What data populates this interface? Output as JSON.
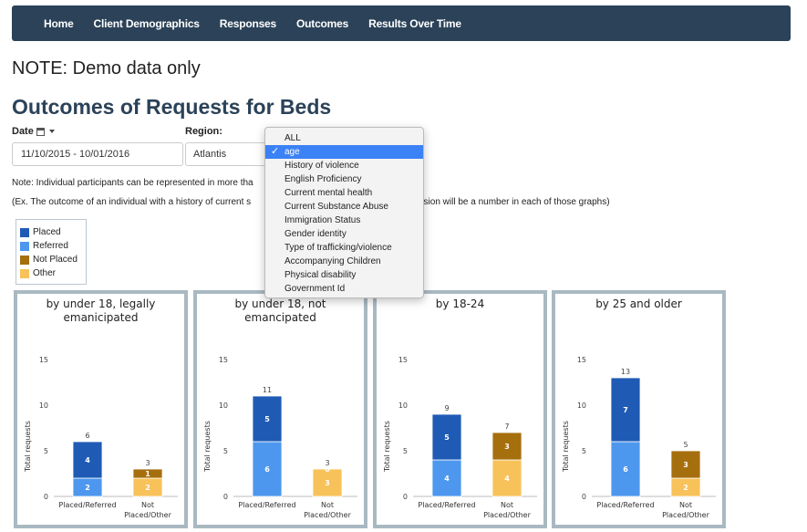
{
  "nav": {
    "items": [
      {
        "label": "Home"
      },
      {
        "label": "Client Demographics"
      },
      {
        "label": "Responses"
      },
      {
        "label": "Outcomes"
      },
      {
        "label": "Results Over Time"
      }
    ]
  },
  "note_demo": "NOTE: Demo data only",
  "page_title": "Outcomes of Requests for Beds",
  "filters": {
    "date_label": "Date",
    "date_value": "11/10/2015 - 10/01/2016",
    "region_label": "Region:",
    "region_value": "Atlantis"
  },
  "notes": {
    "line1": "Note: Individual participants can be represented in more tha",
    "line2": "(Ex. The outcome of an individual with a history of current s",
    "line2_end": "ession will be a number in each of those graphs)"
  },
  "dropdown": {
    "selected": "age",
    "options": [
      {
        "label": "ALL"
      },
      {
        "label": "age"
      },
      {
        "label": "History of violence"
      },
      {
        "label": "English Proficiency"
      },
      {
        "label": "Current mental health"
      },
      {
        "label": "Current Substance Abuse"
      },
      {
        "label": "Immigration Status"
      },
      {
        "label": "Gender identity"
      },
      {
        "label": "Type of trafficking/violence"
      },
      {
        "label": "Accompanying Children"
      },
      {
        "label": "Physical disability"
      },
      {
        "label": "Government Id"
      }
    ]
  },
  "legend": {
    "items": [
      {
        "label": "Placed",
        "color": "#1f5bb5"
      },
      {
        "label": "Referred",
        "color": "#4d98ee"
      },
      {
        "label": "Not Placed",
        "color": "#a66f0e"
      },
      {
        "label": "Other",
        "color": "#f8c25a"
      }
    ]
  },
  "chart_data": [
    {
      "type": "bar",
      "stacked": true,
      "title": "by under 18, legally emanicipated",
      "ylabel": "Total requests",
      "ylim": [
        0,
        15
      ],
      "yticks": [
        0,
        5,
        10,
        15
      ],
      "categories": [
        "Placed/Referred",
        "Not Placed/Other"
      ],
      "series": [
        {
          "name": "Referred",
          "stack": 0,
          "values": [
            2,
            null
          ]
        },
        {
          "name": "Placed",
          "stack": 0,
          "values": [
            4,
            null
          ]
        },
        {
          "name": "Other",
          "stack": 1,
          "values": [
            null,
            2
          ]
        },
        {
          "name": "Not Placed",
          "stack": 1,
          "values": [
            null,
            1
          ]
        }
      ],
      "totals": [
        6,
        3
      ]
    },
    {
      "type": "bar",
      "stacked": true,
      "title": "by under 18, not emancipated",
      "ylabel": "Total requests",
      "ylim": [
        0,
        15
      ],
      "yticks": [
        0,
        5,
        10,
        15
      ],
      "categories": [
        "Placed/Referred",
        "Not Placed/Other"
      ],
      "series": [
        {
          "name": "Referred",
          "stack": 0,
          "values": [
            6,
            null
          ]
        },
        {
          "name": "Placed",
          "stack": 0,
          "values": [
            5,
            null
          ]
        },
        {
          "name": "Other",
          "stack": 1,
          "values": [
            null,
            3
          ]
        },
        {
          "name": "Not Placed",
          "stack": 1,
          "values": [
            null,
            0
          ]
        }
      ],
      "totals": [
        11,
        3
      ]
    },
    {
      "type": "bar",
      "stacked": true,
      "title": "by 18-24",
      "ylabel": "Total requests",
      "ylim": [
        0,
        15
      ],
      "yticks": [
        0,
        5,
        10,
        15
      ],
      "categories": [
        "Placed/Referred",
        "Not Placed/Other"
      ],
      "series": [
        {
          "name": "Referred",
          "stack": 0,
          "values": [
            4,
            null
          ]
        },
        {
          "name": "Placed",
          "stack": 0,
          "values": [
            5,
            null
          ]
        },
        {
          "name": "Other",
          "stack": 1,
          "values": [
            null,
            4
          ]
        },
        {
          "name": "Not Placed",
          "stack": 1,
          "values": [
            null,
            3
          ]
        }
      ],
      "totals": [
        9,
        7
      ]
    },
    {
      "type": "bar",
      "stacked": true,
      "title": "by 25 and older",
      "ylabel": "Total requests",
      "ylim": [
        0,
        15
      ],
      "yticks": [
        0,
        5,
        10,
        15
      ],
      "categories": [
        "Placed/Referred",
        "Not Placed/Other"
      ],
      "series": [
        {
          "name": "Referred",
          "stack": 0,
          "values": [
            6,
            null
          ]
        },
        {
          "name": "Placed",
          "stack": 0,
          "values": [
            7,
            null
          ]
        },
        {
          "name": "Other",
          "stack": 1,
          "values": [
            null,
            2
          ]
        },
        {
          "name": "Not Placed",
          "stack": 1,
          "values": [
            null,
            3
          ]
        }
      ],
      "totals": [
        13,
        5
      ]
    }
  ]
}
